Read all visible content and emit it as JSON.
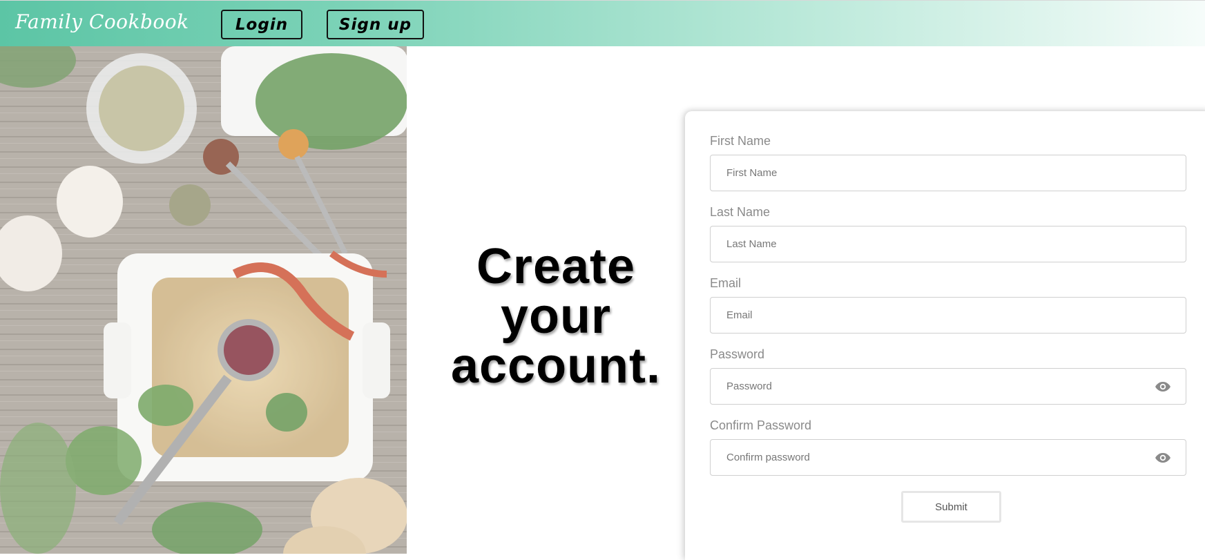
{
  "header": {
    "brand": "Family Cookbook",
    "login_label": "Login",
    "signup_label": "Sign up"
  },
  "hero": {
    "line1": "Create",
    "line2": "your",
    "line3": "account."
  },
  "form": {
    "first_name": {
      "label": "First Name",
      "placeholder": "First Name",
      "value": ""
    },
    "last_name": {
      "label": "Last Name",
      "placeholder": "Last Name",
      "value": ""
    },
    "email": {
      "label": "Email",
      "placeholder": "Email",
      "value": ""
    },
    "password": {
      "label": "Password",
      "placeholder": "Password",
      "value": "",
      "icon": "eye-icon"
    },
    "confirm_password": {
      "label": "Confirm Password",
      "placeholder": "Confirm password",
      "value": "",
      "icon": "eye-icon"
    },
    "submit_label": "Submit"
  },
  "colors": {
    "header_start": "#5cc5a5",
    "header_end": "#f6fcfa",
    "label": "#8a8a8a"
  }
}
